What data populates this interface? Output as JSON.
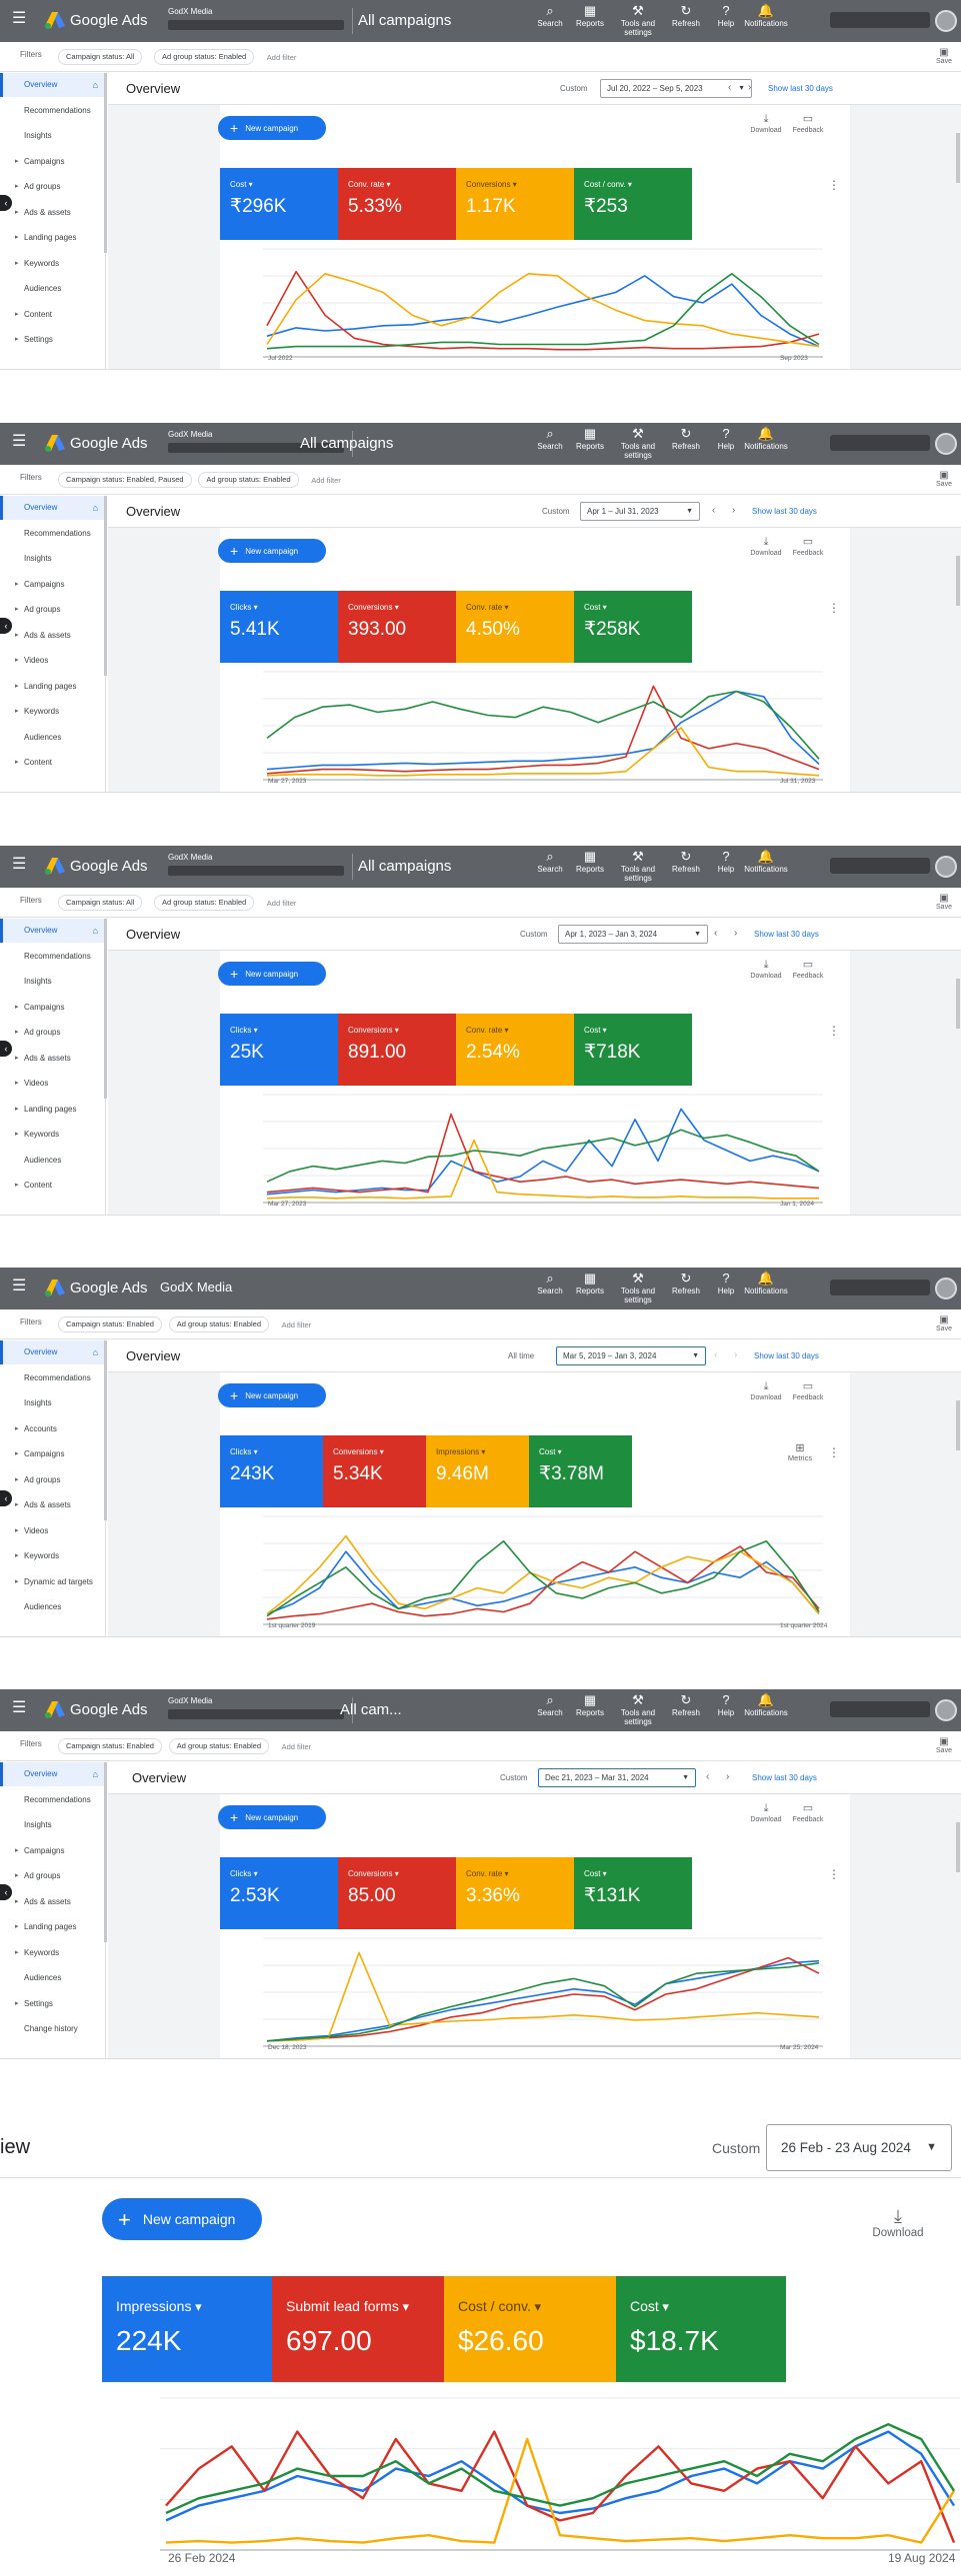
{
  "common": {
    "brand": "Google Ads",
    "tools": [
      {
        "icon": "search-icon",
        "glyph": "⌕",
        "label": "Search"
      },
      {
        "icon": "reports-icon",
        "glyph": "▦",
        "label": "Reports"
      },
      {
        "icon": "wrench-icon",
        "glyph": "⚒",
        "label": "Tools and settings"
      },
      {
        "icon": "refresh-icon",
        "glyph": "↻",
        "label": "Refresh"
      },
      {
        "icon": "help-icon",
        "glyph": "?",
        "label": "Help"
      },
      {
        "icon": "bell-icon",
        "glyph": "🔔",
        "label": "Notifications"
      }
    ],
    "filters_label": "Filters",
    "add_filter": "Add filter",
    "save_label": "Save",
    "overview_title": "Overview",
    "new_campaign": "New campaign",
    "download": "Download",
    "feedback": "Feedback",
    "show_last_30": "Show last 30 days",
    "metrics_label": "Metrics",
    "colors": {
      "blue": "#1a73e8",
      "red": "#d93025",
      "yellow": "#f9ab00",
      "green": "#1e8e3e",
      "topbar": "#5f6368"
    }
  },
  "shots": [
    {
      "account": "GodX Media",
      "crumb": "All campaigns",
      "chips": [
        "Campaign status: All",
        "Ad group status: Enabled"
      ],
      "range_label": "Custom",
      "date_range": "Jul 20, 2022 – Sep 5, 2023",
      "sidebar": [
        "Overview",
        "Recommendations",
        "Insights",
        "Campaigns",
        "Ad groups",
        "Ads & assets",
        "Landing pages",
        "Keywords",
        "Audiences",
        "Content",
        "Settings"
      ],
      "tiles": [
        {
          "label": "Cost",
          "value": "₹296K",
          "color": "blue"
        },
        {
          "label": "Conv. rate",
          "value": "5.33%",
          "color": "red"
        },
        {
          "label": "Conversions",
          "value": "1.17K",
          "color": "yellow"
        },
        {
          "label": "Cost / conv.",
          "value": "₹253",
          "color": "green"
        }
      ],
      "x_start": "Jul 2022",
      "x_end": "Sep 2023",
      "chart_data": {
        "type": "line",
        "series": [
          {
            "color": "blue",
            "values": [
              20,
              28,
              25,
              27,
              30,
              31,
              35,
              38,
              33,
              40,
              48,
              55,
              62,
              78,
              58,
              52,
              70,
              40,
              22,
              10
            ]
          },
          {
            "color": "red",
            "values": [
              30,
              82,
              40,
              18,
              12,
              10,
              8,
              9,
              8,
              8,
              7,
              7,
              8,
              9,
              8,
              8,
              9,
              10,
              14,
              22
            ]
          },
          {
            "color": "yellow",
            "values": [
              12,
              55,
              80,
              72,
              62,
              40,
              30,
              38,
              62,
              80,
              78,
              58,
              45,
              35,
              32,
              30,
              22,
              18,
              14,
              10
            ]
          },
          {
            "color": "green",
            "values": [
              8,
              10,
              10,
              10,
              10,
              12,
              14,
              14,
              12,
              12,
              12,
              12,
              14,
              16,
              30,
              60,
              80,
              58,
              30,
              12
            ]
          }
        ]
      }
    },
    {
      "account": "GodX Media",
      "crumb": "All campaigns",
      "chips": [
        "Campaign status: Enabled, Paused",
        "Ad group status: Enabled"
      ],
      "range_label": "Custom",
      "date_range": "Apr 1 – Jul 31, 2023",
      "sidebar": [
        "Overview",
        "Recommendations",
        "Insights",
        "Campaigns",
        "Ad groups",
        "Ads & assets",
        "Videos",
        "Landing pages",
        "Keywords",
        "Audiences",
        "Content"
      ],
      "tiles": [
        {
          "label": "Clicks",
          "value": "5.41K",
          "color": "blue"
        },
        {
          "label": "Conversions",
          "value": "393.00",
          "color": "red"
        },
        {
          "label": "Conv. rate",
          "value": "4.50%",
          "color": "yellow"
        },
        {
          "label": "Cost",
          "value": "₹258K",
          "color": "green"
        }
      ],
      "x_start": "Mar 27, 2023",
      "x_end": "Jul 31, 2023",
      "chart_data": {
        "type": "line",
        "series": [
          {
            "color": "blue",
            "values": [
              10,
              12,
              14,
              14,
              15,
              16,
              15,
              16,
              17,
              18,
              18,
              20,
              22,
              25,
              30,
              55,
              70,
              85,
              80,
              40,
              15
            ]
          },
          {
            "color": "red",
            "values": [
              6,
              8,
              10,
              10,
              9,
              8,
              9,
              10,
              10,
              12,
              14,
              14,
              16,
              22,
              90,
              40,
              30,
              35,
              30,
              20,
              10
            ]
          },
          {
            "color": "yellow",
            "values": [
              4,
              5,
              5,
              5,
              4,
              4,
              5,
              5,
              5,
              6,
              6,
              6,
              6,
              8,
              30,
              50,
              12,
              8,
              8,
              6,
              4
            ]
          },
          {
            "color": "green",
            "values": [
              40,
              60,
              70,
              72,
              65,
              68,
              75,
              68,
              62,
              60,
              70,
              65,
              55,
              65,
              75,
              60,
              80,
              85,
              75,
              50,
              20
            ]
          }
        ]
      }
    },
    {
      "account": "GodX Media",
      "crumb": "All campaigns",
      "chips": [
        "Campaign status: All",
        "Ad group status: Enabled"
      ],
      "range_label": "Custom",
      "date_range": "Apr 1, 2023 – Jan 3, 2024",
      "sidebar": [
        "Overview",
        "Recommendations",
        "Insights",
        "Campaigns",
        "Ad groups",
        "Ads & assets",
        "Videos",
        "Landing pages",
        "Keywords",
        "Audiences",
        "Content"
      ],
      "tiles": [
        {
          "label": "Clicks",
          "value": "25K",
          "color": "blue"
        },
        {
          "label": "Conversions",
          "value": "891.00",
          "color": "red"
        },
        {
          "label": "Conv. rate",
          "value": "2.54%",
          "color": "yellow"
        },
        {
          "label": "Cost",
          "value": "₹718K",
          "color": "green"
        }
      ],
      "x_start": "Mar 27, 2023",
      "x_end": "Jan 1, 2024",
      "chart_data": {
        "type": "line",
        "series": [
          {
            "color": "blue",
            "values": [
              8,
              10,
              12,
              10,
              12,
              14,
              12,
              12,
              40,
              30,
              20,
              25,
              40,
              30,
              60,
              35,
              80,
              40,
              90,
              60,
              50,
              40,
              45,
              40,
              30
            ]
          },
          {
            "color": "red",
            "values": [
              10,
              12,
              14,
              12,
              10,
              12,
              14,
              10,
              85,
              30,
              25,
              20,
              22,
              25,
              20,
              22,
              18,
              20,
              22,
              20,
              18,
              20,
              18,
              16,
              14
            ]
          },
          {
            "color": "yellow",
            "values": [
              4,
              5,
              5,
              4,
              5,
              5,
              4,
              5,
              6,
              60,
              10,
              8,
              7,
              6,
              5,
              6,
              5,
              5,
              6,
              5,
              5,
              5,
              4,
              4,
              4
            ]
          },
          {
            "color": "green",
            "values": [
              20,
              30,
              35,
              32,
              36,
              40,
              38,
              44,
              45,
              50,
              48,
              45,
              52,
              55,
              58,
              62,
              55,
              60,
              70,
              62,
              65,
              58,
              50,
              45,
              30
            ]
          }
        ]
      }
    },
    {
      "account": "GodX Media",
      "crumb": "",
      "chips": [
        "Campaign status: Enabled",
        "Ad group status: Enabled"
      ],
      "range_label": "All time",
      "date_range": "Mar 5, 2019 – Jan 3, 2024",
      "sidebar": [
        "Overview",
        "Recommendations",
        "Insights",
        "Accounts",
        "Campaigns",
        "Ad groups",
        "Ads & assets",
        "Videos",
        "Keywords",
        "Dynamic ad targets",
        "Audiences"
      ],
      "tiles": [
        {
          "label": "Clicks",
          "value": "243K",
          "color": "blue"
        },
        {
          "label": "Conversions",
          "value": "5.34K",
          "color": "red"
        },
        {
          "label": "Impressions",
          "value": "9.46M",
          "color": "yellow"
        },
        {
          "label": "Cost",
          "value": "₹3.78M",
          "color": "green"
        }
      ],
      "x_start": "1st quarter 2019",
      "x_end": "1st quarter 2024",
      "chart_data": {
        "type": "line",
        "series": [
          {
            "color": "blue",
            "values": [
              10,
              20,
              35,
              70,
              40,
              15,
              20,
              25,
              18,
              22,
              30,
              40,
              45,
              50,
              55,
              45,
              40,
              50,
              45,
              60,
              40,
              10
            ]
          },
          {
            "color": "red",
            "values": [
              5,
              8,
              10,
              15,
              20,
              12,
              8,
              10,
              15,
              12,
              20,
              45,
              60,
              50,
              70,
              55,
              40,
              60,
              75,
              50,
              45,
              15
            ]
          },
          {
            "color": "yellow",
            "values": [
              10,
              30,
              55,
              85,
              50,
              20,
              15,
              25,
              35,
              30,
              50,
              40,
              35,
              45,
              40,
              55,
              65,
              60,
              70,
              55,
              40,
              10
            ]
          },
          {
            "color": "green",
            "values": [
              8,
              25,
              40,
              55,
              30,
              15,
              25,
              30,
              60,
              80,
              50,
              30,
              25,
              35,
              40,
              30,
              35,
              45,
              70,
              80,
              50,
              12
            ]
          }
        ]
      }
    },
    {
      "account": "GodX Media",
      "crumb": "All cam...",
      "chips": [
        "Campaign status: Enabled",
        "Ad group status: Enabled"
      ],
      "range_label": "Custom",
      "date_range": "Dec 21, 2023 – Mar 31, 2024",
      "sidebar": [
        "Overview",
        "Recommendations",
        "Insights",
        "Campaigns",
        "Ad groups",
        "Ads & assets",
        "Landing pages",
        "Keywords",
        "Audiences",
        "Settings",
        "Change history"
      ],
      "tiles": [
        {
          "label": "Clicks",
          "value": "2.53K",
          "color": "blue"
        },
        {
          "label": "Conversions",
          "value": "85.00",
          "color": "red"
        },
        {
          "label": "Conv. rate",
          "value": "3.36%",
          "color": "yellow"
        },
        {
          "label": "Cost",
          "value": "₹131K",
          "color": "green"
        }
      ],
      "x_start": "Dec 18, 2023",
      "x_end": "Mar 25, 2024",
      "chart_data": {
        "type": "line",
        "series": [
          {
            "color": "blue",
            "values": [
              5,
              8,
              10,
              15,
              20,
              28,
              35,
              40,
              45,
              50,
              55,
              52,
              40,
              60,
              65,
              70,
              75,
              80,
              82
            ]
          },
          {
            "color": "red",
            "values": [
              5,
              6,
              8,
              10,
              14,
              20,
              28,
              32,
              40,
              45,
              50,
              48,
              35,
              50,
              55,
              65,
              75,
              85,
              70
            ]
          },
          {
            "color": "yellow",
            "values": [
              5,
              6,
              8,
              90,
              20,
              22,
              24,
              25,
              27,
              28,
              30,
              28,
              25,
              26,
              28,
              30,
              32,
              30,
              28
            ]
          },
          {
            "color": "green",
            "values": [
              5,
              7,
              9,
              12,
              18,
              30,
              38,
              45,
              52,
              60,
              65,
              58,
              38,
              60,
              70,
              72,
              74,
              76,
              80
            ]
          }
        ]
      }
    }
  ],
  "zoom": {
    "overview_partial": "iew",
    "range_label": "Custom",
    "date_range": "26 Feb - 23 Aug 2024",
    "new_campaign": "New campaign",
    "download": "Download",
    "tiles": [
      {
        "label": "Impressions",
        "value": "224K",
        "color": "blue"
      },
      {
        "label": "Submit lead forms",
        "value": "697.00",
        "color": "red"
      },
      {
        "label": "Cost / conv.",
        "value": "$26.60",
        "color": "yellow"
      },
      {
        "label": "Cost",
        "value": "$18.7K",
        "color": "green"
      }
    ],
    "x_start": "26 Feb 2024",
    "x_end": "19 Aug 2024",
    "chart_data": {
      "type": "line",
      "series": [
        {
          "color": "blue",
          "values": [
            20,
            30,
            35,
            40,
            50,
            45,
            40,
            55,
            50,
            60,
            45,
            30,
            25,
            28,
            35,
            40,
            50,
            55,
            45,
            60,
            55,
            70,
            80,
            65,
            30
          ]
        },
        {
          "color": "red",
          "values": [
            30,
            55,
            70,
            40,
            80,
            50,
            35,
            75,
            45,
            40,
            80,
            30,
            20,
            25,
            50,
            70,
            45,
            40,
            55,
            60,
            35,
            70,
            45,
            60,
            5
          ]
        },
        {
          "color": "yellow",
          "values": [
            5,
            6,
            5,
            6,
            8,
            6,
            5,
            8,
            10,
            6,
            5,
            75,
            10,
            8,
            6,
            7,
            8,
            6,
            8,
            10,
            8,
            8,
            10,
            5,
            40
          ]
        },
        {
          "color": "green",
          "values": [
            25,
            35,
            40,
            45,
            55,
            50,
            50,
            60,
            45,
            55,
            40,
            35,
            30,
            35,
            45,
            50,
            55,
            60,
            50,
            65,
            60,
            75,
            85,
            75,
            40
          ]
        }
      ]
    }
  }
}
